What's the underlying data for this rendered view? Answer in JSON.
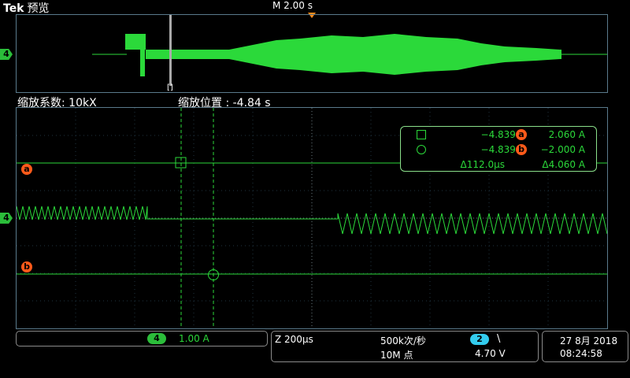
{
  "header": {
    "brand": "Tek",
    "mode": "预览",
    "timebase": "M 2.00 s"
  },
  "overview": {
    "cursor_marker": "[]",
    "channel_label": "4"
  },
  "zoom": {
    "factor_label": "缩放系数: 10kX",
    "position_label": "缩放位置 :  -4.84 s"
  },
  "cursors": {
    "a_label": "a",
    "b_label": "b",
    "ch_label": "4"
  },
  "readout": {
    "row1_time": "−4.839 s",
    "row1_badge": "a",
    "row1_value": "2.060 A",
    "row2_time": "−4.839 s",
    "row2_badge": "b",
    "row2_value": "−2.000 A",
    "delta_time": "Δ112.0µs",
    "delta_value": "Δ4.060 A"
  },
  "status": {
    "channel_num": "4",
    "channel_scale": "1.00 A",
    "zoom_scale": "Z 200µs",
    "sample_rate": "500k次/秒",
    "record_length": "10M 点",
    "trig_channel": "2",
    "trig_slope": "\\",
    "trig_level": "4.70 V",
    "date": "27 8月 2018",
    "time": "08:24:58"
  },
  "colors": {
    "trace": "#2bd93a",
    "cursor": "#ff5a1a",
    "trigger": "#ff8c1a",
    "grid": "#5a7a8c"
  }
}
